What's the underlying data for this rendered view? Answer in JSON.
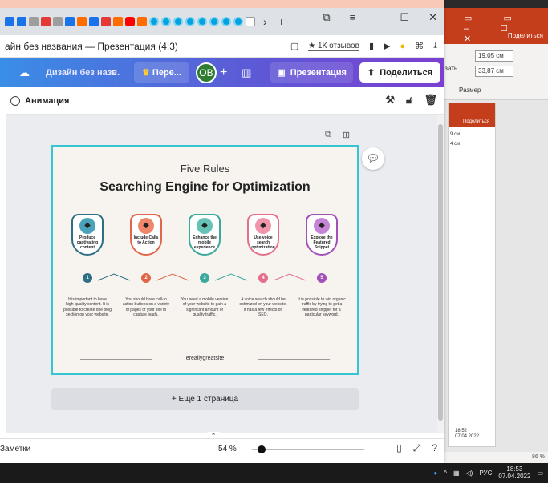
{
  "browser": {
    "new_tab_symbol": "+",
    "tab_next_symbol": "›",
    "window_controls": [
      "⧉",
      "≡",
      "–",
      "☐",
      "✕"
    ],
    "page_title": "айн без названия — Презентация (4:3)",
    "reviews_label": "★ 1К отзывов"
  },
  "canva": {
    "design_name": "Дизайн без назв...",
    "resize_label": "Пере...",
    "avatar_initials": "OB",
    "present_label": "Презентация",
    "share_label": "Поделиться",
    "toolbar_animation": "Анимация",
    "more_pages": "+ Еще 1 страница",
    "notes_label": "Заметки",
    "zoom": "54 %",
    "zoom_fraction": 0.05
  },
  "slide": {
    "title_small": "Five Rules",
    "title_main": "Searching Engine for Optimization",
    "footer": "ereallygreatsite",
    "rules": [
      {
        "label": "Produce captivating content",
        "num": "1",
        "color": "#2f6f86",
        "icon_bg": "#4aa3b8",
        "desc": "It is important to have high-quality content. It is possible to create one blog section on your website."
      },
      {
        "label": "Include Calls to Action",
        "num": "2",
        "color": "#e0664a",
        "icon_bg": "#f0876a",
        "desc": "You should have call-to action buttons on a variety of pages of your site to capture leads."
      },
      {
        "label": "Enhance the mobile experience",
        "num": "3",
        "color": "#3aa89b",
        "icon_bg": "#66c2b5",
        "desc": "You need a mobile version of your website to gain a significant amount of quality traffic."
      },
      {
        "label": "Use voice search optimization",
        "num": "4",
        "color": "#e46f8a",
        "icon_bg": "#f196aa",
        "desc": "A voice search should be optimized on your website. It has a few effects on SEO."
      },
      {
        "label": "Explore the Featured Snippet",
        "num": "5",
        "color": "#a24fb8",
        "icon_bg": "#c584d6",
        "desc": "It is possible to win organic traffic by trying to get a featured snippet for a particular keyword."
      }
    ]
  },
  "ppt": {
    "share": "Поделиться",
    "size_label": "Размер",
    "width_value": "19,05 см",
    "height_value": "33,87 см",
    "crop_label": "езать",
    "zoom": "86 %",
    "mini_share": "Поделиться",
    "mini_w": "9 см",
    "mini_h": "4 см",
    "mini_time": "18:52",
    "mini_date": "07.04.2022"
  },
  "taskbar": {
    "lang": "РУС",
    "time": "18:53",
    "date": "07.04.2022"
  }
}
